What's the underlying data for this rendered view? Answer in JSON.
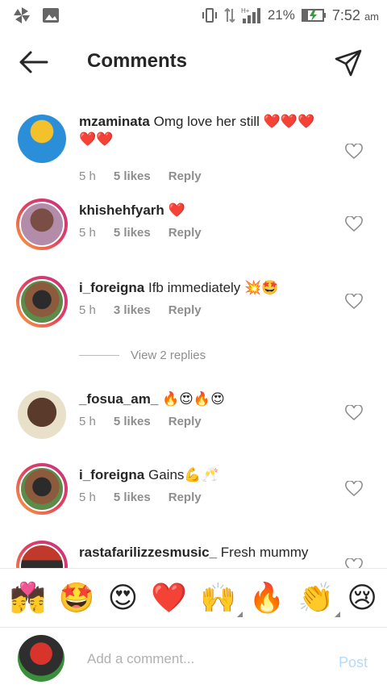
{
  "status": {
    "battery": "21%",
    "time": "7:52",
    "ampm": "am"
  },
  "header": {
    "title": "Comments"
  },
  "comments": [
    {
      "user": "mzaminata",
      "text": "Omg love her still ❤️❤️❤️❤️❤️",
      "time": "5 h",
      "likes": "5 likes",
      "reply": "Reply"
    },
    {
      "user": "khishehfyarh",
      "text": "❤️",
      "time": "5 h",
      "likes": "5 likes",
      "reply": "Reply"
    },
    {
      "user": "i_foreigna",
      "text": "Ifb immediately 💥🤩",
      "time": "5 h",
      "likes": "3 likes",
      "reply": "Reply"
    },
    {
      "user": "_fosua_am_",
      "text": "🔥😍🔥😍",
      "time": "5 h",
      "likes": "5 likes",
      "reply": "Reply"
    },
    {
      "user": "i_foreigna",
      "text": "Gains💪🥂",
      "time": "5 h",
      "likes": "5 likes",
      "reply": "Reply"
    },
    {
      "user": "rastafarilizzesmusic_",
      "text": "Fresh mummy",
      "time": "",
      "likes": "",
      "reply": ""
    }
  ],
  "view_replies": "View 2 replies",
  "emoji_bar": [
    "💏",
    "🤩",
    "😍",
    "❤️",
    "🙌",
    "🔥",
    "👏",
    "😢"
  ],
  "input": {
    "placeholder": "Add a comment...",
    "post_label": "Post"
  },
  "colors": {
    "accent": "#b3dbfb",
    "muted": "#8e8e8e",
    "heart_red": "#ed1c24"
  }
}
